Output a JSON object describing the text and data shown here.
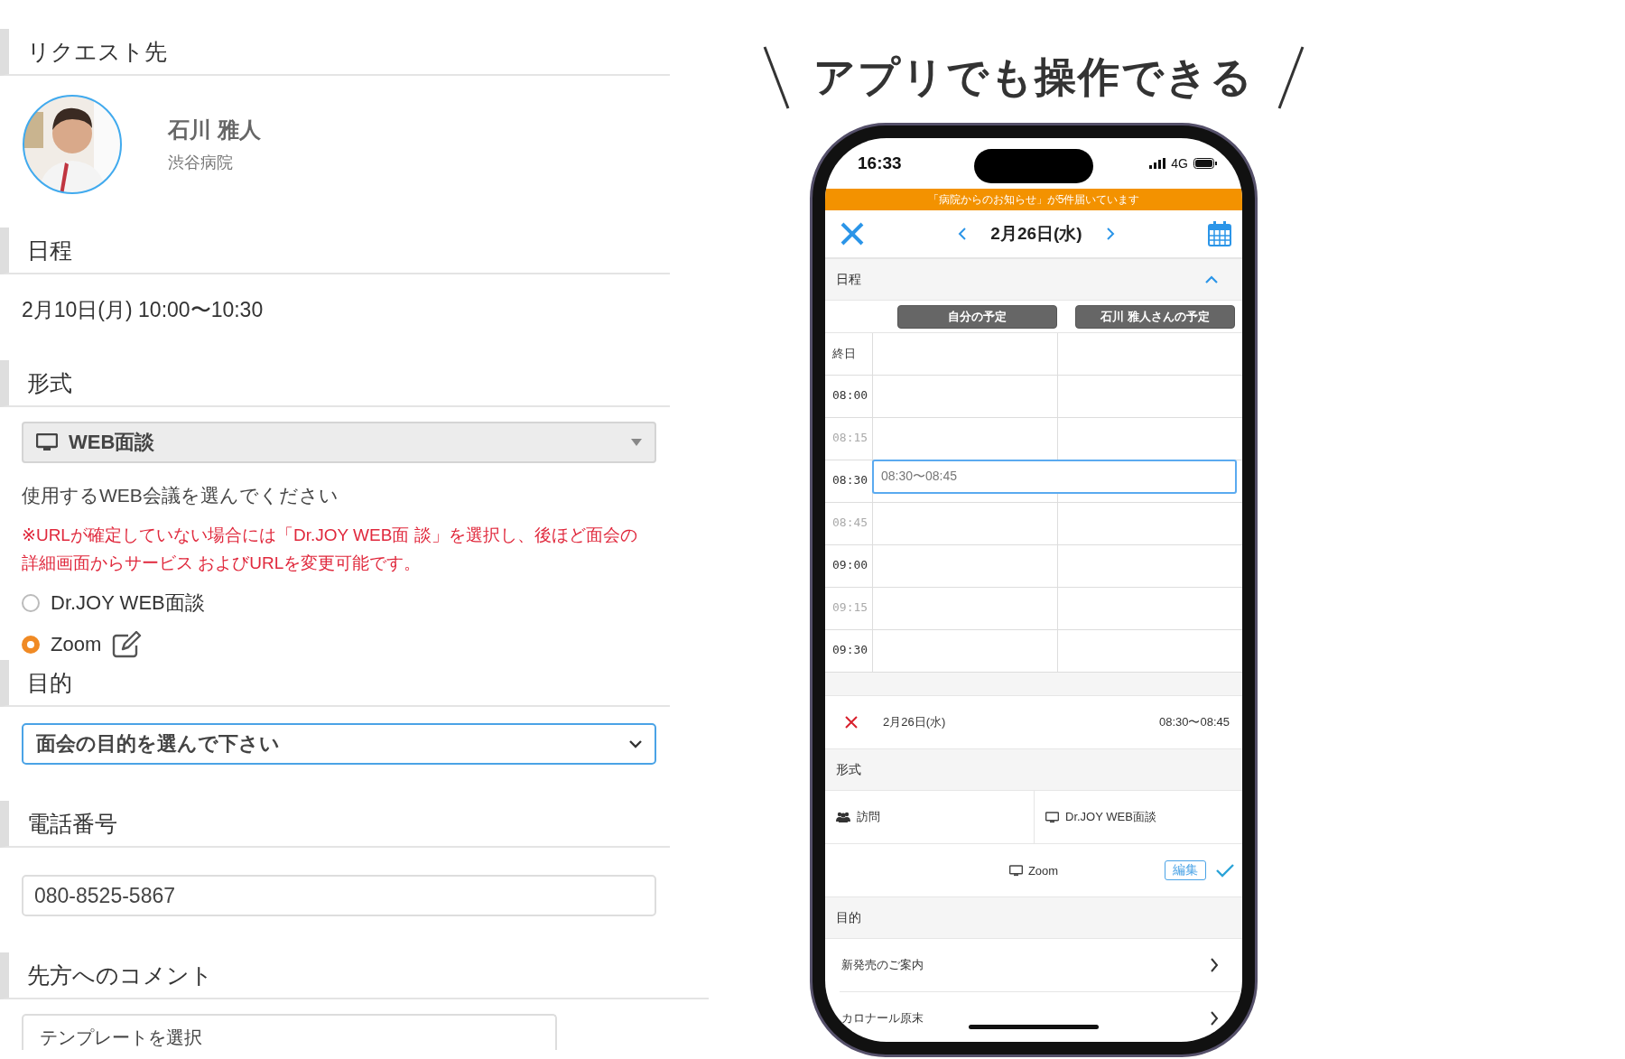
{
  "request_to": {
    "heading": "リクエスト先",
    "name": "石川 雅人",
    "hospital": "渋谷病院"
  },
  "schedule": {
    "heading": "日程",
    "value": "2月10日(月) 10:00〜10:30"
  },
  "format": {
    "heading": "形式",
    "select_value": "WEB面談",
    "prompt": "使用するWEB会議を選んでください",
    "note": "※URLが確定していない場合には「Dr.JOY WEB面 談」を選択し、後ほど面会の詳細画面からサービス およびURLを変更可能です。",
    "options": [
      {
        "label": "Dr.JOY WEB面談",
        "selected": false,
        "editable": false
      },
      {
        "label": "Zoom",
        "selected": true,
        "editable": true
      }
    ]
  },
  "purpose": {
    "heading": "目的",
    "select_value": "面会の目的を選んで下さい",
    "focused": true
  },
  "phone": {
    "heading": "電話番号",
    "value": "080-8525-5867"
  },
  "comment": {
    "heading": "先方へのコメント",
    "template_select": "テンプレートを選択"
  },
  "promo_title": "アプリでも操作できる",
  "app": {
    "status_time": "16:33",
    "network": "4G",
    "banner": "「病院からのお知らせ」が5件届いています",
    "date": "2月26日(水)",
    "schedule_section": {
      "heading": "日程",
      "expanded": true
    },
    "columns": [
      "自分の予定",
      "石川 雅人さんの予定"
    ],
    "time_slots": [
      {
        "label": "終日",
        "kind": "allday"
      },
      {
        "label": "08:00",
        "kind": "hour"
      },
      {
        "label": "08:15",
        "kind": "quarter"
      },
      {
        "label": "08:30",
        "kind": "hour",
        "event": "08:30〜08:45"
      },
      {
        "label": "08:45",
        "kind": "quarter"
      },
      {
        "label": "09:00",
        "kind": "hour"
      },
      {
        "label": "09:15",
        "kind": "quarter"
      },
      {
        "label": "09:30",
        "kind": "hour"
      }
    ],
    "selection": {
      "date": "2月26日(水)",
      "time": "08:30〜08:45"
    },
    "format_section": {
      "heading": "形式",
      "options": [
        {
          "label": "訪問",
          "kind": "visit"
        },
        {
          "label": "Dr.JOY WEB面談",
          "kind": "web"
        }
      ],
      "chosen": {
        "label": "Zoom",
        "edit": "編集",
        "confirmed": true
      }
    },
    "purpose_section": {
      "heading": "目的",
      "items": [
        "新発売のご案内",
        "カロナール原末"
      ]
    }
  }
}
